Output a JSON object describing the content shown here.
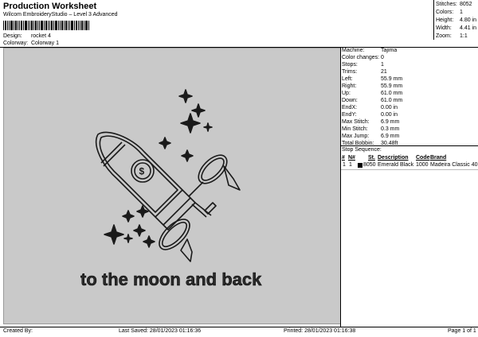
{
  "header": {
    "title": "Production Worksheet",
    "subtitle": "Wilcom EmbroideryStudio – Level 3 Advanced"
  },
  "design_info": {
    "design_label": "Design:",
    "design_value": "rocket 4",
    "colorway_label": "Colorway:",
    "colorway_value": "Colorway 1"
  },
  "stats": {
    "stitches_label": "Stitches:",
    "stitches_value": "8052",
    "colors_label": "Colors:",
    "colors_value": "1",
    "height_label": "Height:",
    "height_value": "4.80 in",
    "width_label": "Width:",
    "width_value": "4.41 in",
    "zoom_label": "Zoom:",
    "zoom_value": "1:1"
  },
  "design_preview": {
    "slogan": "to the moon and back",
    "background_color": "#c9c9c9",
    "stitch_color": "#1a1a1a"
  },
  "properties": [
    {
      "label": "Machine:",
      "value": "Tajima"
    },
    {
      "label": "Color changes:",
      "value": "0"
    },
    {
      "label": "Stops:",
      "value": "1"
    },
    {
      "label": "Trims:",
      "value": "21"
    },
    {
      "label": "Left:",
      "value": "55.9 mm"
    },
    {
      "label": "Right:",
      "value": "55.9 mm"
    },
    {
      "label": "Up:",
      "value": "61.0 mm"
    },
    {
      "label": "Down:",
      "value": "61.0 mm"
    },
    {
      "label": "EndX:",
      "value": "0.00 in"
    },
    {
      "label": "EndY:",
      "value": "0.00 in"
    },
    {
      "label": "Max Stitch:",
      "value": "6.9 mm"
    },
    {
      "label": "Min Stitch:",
      "value": "0.3 mm"
    },
    {
      "label": "Max Jump:",
      "value": "6.9 mm"
    },
    {
      "label": "Total Bobbin:",
      "value": "30.48ft"
    }
  ],
  "stop_sequence": {
    "heading": "Stop Sequence:",
    "columns": [
      "#",
      "N#",
      "St.",
      "Description",
      "Code",
      "Brand"
    ],
    "rows": [
      {
        "num": "1",
        "n": "1",
        "st": "8050",
        "description": "Emerald Black",
        "code": "1000",
        "brand": "Madeira Classic 40",
        "color": "#000000"
      }
    ]
  },
  "footer": {
    "created_by": "Created By:",
    "last_saved": "Last Saved: 28/01/2023 01:16:36",
    "printed": "Printed: 28/01/2023 01:16:38",
    "page": "Page 1 of 1"
  }
}
